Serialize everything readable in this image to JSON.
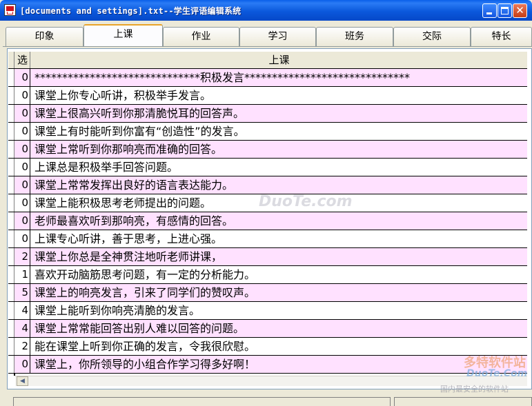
{
  "window": {
    "title": "[documents and settings].txt--学生评语编辑系统"
  },
  "tabs": [
    {
      "label": "印象",
      "active": false
    },
    {
      "label": "上课",
      "active": true
    },
    {
      "label": "作业",
      "active": false
    },
    {
      "label": "学习",
      "active": false
    },
    {
      "label": "班务",
      "active": false
    },
    {
      "label": "交际",
      "active": false
    },
    {
      "label": "特长",
      "active": false
    }
  ],
  "grid": {
    "columns": [
      "选",
      "上课"
    ],
    "rows": [
      {
        "sel": "0",
        "text": "******************************积极发言******************************",
        "tint": "pink"
      },
      {
        "sel": "0",
        "text": "课堂上你专心听讲，积极举手发言。",
        "tint": "white"
      },
      {
        "sel": "0",
        "text": "课堂上很高兴听到你那清脆悦耳的回答声。",
        "tint": "pink"
      },
      {
        "sel": "0",
        "text": "课堂上有时能听到你富有“创造性”的发言。",
        "tint": "white"
      },
      {
        "sel": "0",
        "text": "课堂上常听到你那响亮而准确的回答。",
        "tint": "pink"
      },
      {
        "sel": "0",
        "text": "上课总是积极举手回答问题。",
        "tint": "white"
      },
      {
        "sel": "0",
        "text": "课堂上常常发挥出良好的语言表达能力。",
        "tint": "pink"
      },
      {
        "sel": "0",
        "text": "课堂上能积极思考老师提出的问题。",
        "tint": "white"
      },
      {
        "sel": "0",
        "text": "老师最喜欢听到那响亮，有感情的回答。",
        "tint": "pink"
      },
      {
        "sel": "0",
        "text": "上课专心听讲，善于思考，上进心强。",
        "tint": "white"
      },
      {
        "sel": "2",
        "text": "课堂上你总是全神贯注地听老师讲课，",
        "tint": "pink"
      },
      {
        "sel": "1",
        "text": "喜欢开动脑筋思考问题，有一定的分析能力。",
        "tint": "white"
      },
      {
        "sel": "5",
        "text": "课堂上的响亮发言，引来了同学们的赞叹声。",
        "tint": "pink"
      },
      {
        "sel": "4",
        "text": "课堂上能听到你响亮清脆的发言。",
        "tint": "white"
      },
      {
        "sel": "4",
        "text": "课堂上常常能回答出别人难以回答的问题。",
        "tint": "pink"
      },
      {
        "sel": "2",
        "text": "能在课堂上听到你正确的发言，令我很欣慰。",
        "tint": "white"
      },
      {
        "sel": "0",
        "text": "课堂上，你所领导的小组合作学习得多好啊！",
        "tint": "pink"
      }
    ]
  },
  "watermarks": {
    "center": "DuoTe.com",
    "corner_brand": "多特软件站",
    "corner_url": "DuoTe.Com",
    "corner_tagline": "国内最安全的软件站"
  },
  "colors": {
    "pink_row": "#ffe1ff",
    "title_bar": "#0b58dc",
    "active_tab_accent": "#e9a329"
  }
}
